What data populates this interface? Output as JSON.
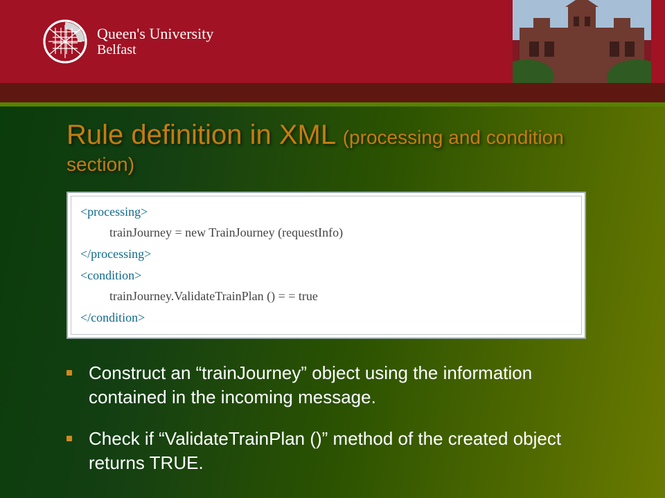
{
  "header": {
    "university_line1": "Queen's University",
    "university_line2": "Belfast"
  },
  "title": {
    "main": "Rule definition in XML ",
    "sub": "(processing and condition section)"
  },
  "code": {
    "l1": "<processing>",
    "l2": "trainJourney = new TrainJourney (requestInfo)",
    "l3": "</processing>",
    "l4": "<condition>",
    "l5": "trainJourney.ValidateTrainPlan () = = true",
    "l6": "</condition>"
  },
  "bullets": {
    "b1": "Construct an “trainJourney” object using the information contained in the incoming message.",
    "b2": "Check if “ValidateTrainPlan ()” method of the created object returns TRUE."
  }
}
